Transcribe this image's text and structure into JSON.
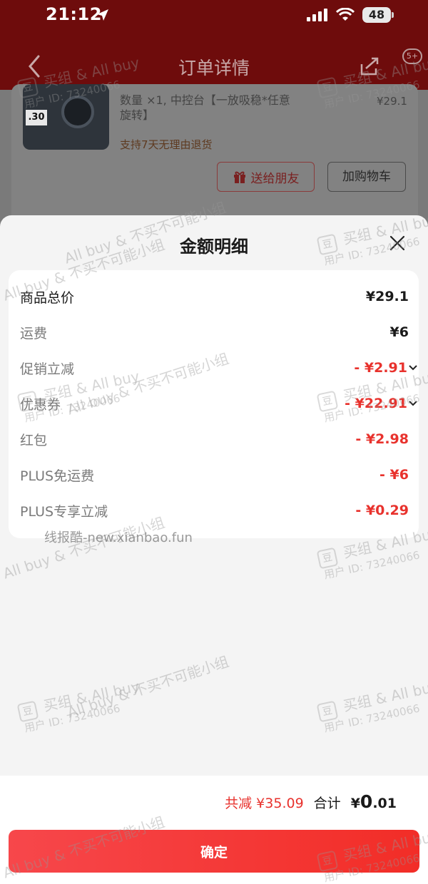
{
  "status_bar": {
    "time": "21:12",
    "battery": "48"
  },
  "background_page": {
    "nav_title": "订单详情",
    "more_badge": "5+",
    "product": {
      "thumb_price": ".30",
      "spec_line1": "数量 ×1, 中控台【一放吸稳*任意",
      "spec_line2": "旋转】",
      "price": "¥29.1",
      "return_note": "支持7天无理由退货"
    },
    "buttons": {
      "gift": "送给朋友",
      "cart": "加购物车"
    }
  },
  "sheet": {
    "title": "金额明细",
    "rows": [
      {
        "label": "商品总价",
        "value": "¥29.1"
      },
      {
        "label": "运费",
        "value": "¥6"
      },
      {
        "label": "促销立减",
        "value": "- ¥2.91"
      },
      {
        "label": "优惠券",
        "value": "- ¥22.91"
      },
      {
        "label": "红包",
        "value": "- ¥2.98"
      },
      {
        "label": "PLUS免运费",
        "value": "- ¥6"
      },
      {
        "label": "PLUS专享立减",
        "value": "- ¥0.29"
      }
    ],
    "footer": {
      "total_reduce": "共减 ¥35.09",
      "total_label": "合计",
      "total_value_prefix": "¥",
      "total_value_int": "0",
      "total_value_dec": ".01",
      "confirm": "确定"
    }
  },
  "watermarks": {
    "group_line1": "买组 & All buy",
    "group_line2": "用户 ID: 73240066",
    "logo_char": "豆",
    "slogan": "All buy & 不买不可能小组",
    "site_mark": "线报酷-new.xianbao.fun"
  },
  "colors": {
    "accent_red": "#e8322d",
    "button_red": "#f22d27"
  }
}
